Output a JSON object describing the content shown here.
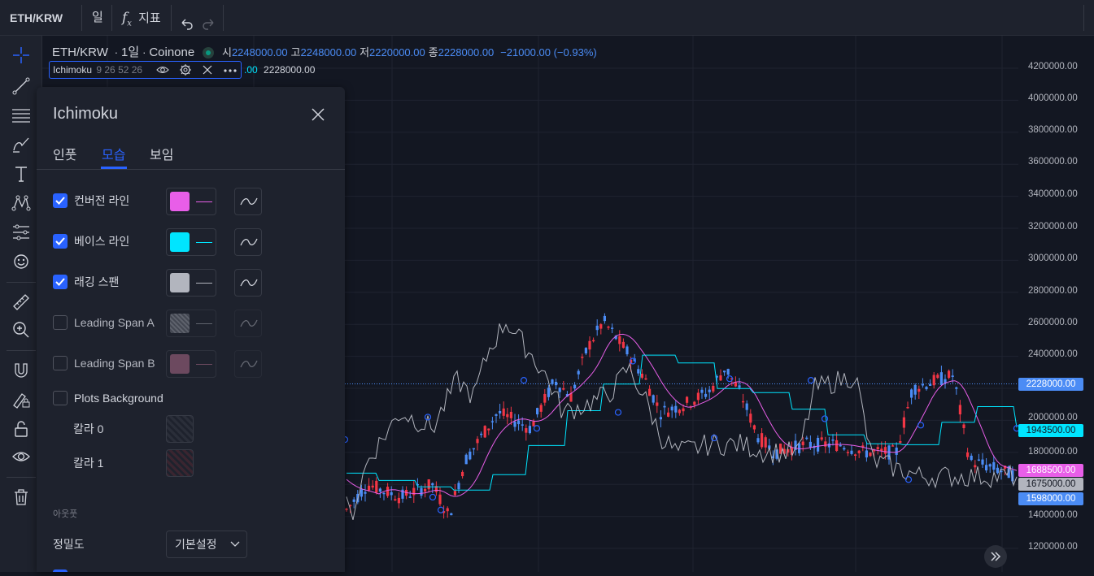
{
  "topbar": {
    "symbol": "ETH/KRW",
    "interval": "일",
    "indicators_label": "지표",
    "fx_f": "f",
    "fx_x": "x"
  },
  "sidebar": {
    "tools": [
      "crosshair-icon",
      "trendline-icon",
      "horizontal-lines-icon",
      "brush-icon",
      "text-icon",
      "pattern-icon",
      "prediction-icon",
      "emoji-icon",
      "ruler-icon",
      "zoom-in-icon",
      "magnet-icon",
      "lock-drawing-icon",
      "lock-icon",
      "eye-icon",
      "trash-icon"
    ]
  },
  "legend": {
    "symbol": "ETH/KRW",
    "interval": "1일",
    "exchange": "Coinone",
    "open_label": "시",
    "open": "2248000.00",
    "high_label": "고",
    "high": "2248000.00",
    "low_label": "저",
    "low": "2220000.00",
    "close_label": "종",
    "close": "2228000.00",
    "change": "−21000.00 (−0.93%)"
  },
  "indicator": {
    "name": "Ichimoku",
    "params": "9 26 52 26",
    "value1": ".00",
    "value2": "2228000.00"
  },
  "dialog": {
    "title": "Ichimoku",
    "tabs": [
      {
        "label": "인풋",
        "active": false
      },
      {
        "label": "모습",
        "active": true
      },
      {
        "label": "보임",
        "active": false
      }
    ],
    "rows": [
      {
        "label": "컨버전 라인",
        "checked": true,
        "color": "#e85ee8"
      },
      {
        "label": "베이스 라인",
        "checked": true,
        "color": "#00e5ff"
      },
      {
        "label": "래깅 스팬",
        "checked": true,
        "color": "#b2b5be"
      },
      {
        "label": "Leading Span A",
        "checked": false,
        "color": "#8a8d96"
      },
      {
        "label": "Leading Span B",
        "checked": false,
        "color": "#8e5a75"
      }
    ],
    "plots_background": {
      "label": "Plots Background",
      "checked": false
    },
    "color0_label": "칼라 0",
    "color1_label": "칼라 1",
    "outputs_section": "아웃풋",
    "precision_label": "정밀도",
    "precision_value": "기본설정"
  },
  "yaxis": {
    "ticks": [
      "4200000.00",
      "4000000.00",
      "3800000.00",
      "3600000.00",
      "3400000.00",
      "3200000.00",
      "3000000.00",
      "2800000.00",
      "2600000.00",
      "2400000.00",
      "2000000.00",
      "1800000.00",
      "1400000.00",
      "1200000.00"
    ],
    "tags": [
      {
        "text": "2228000.00",
        "bg": "#4b8cf5",
        "fg": "#ffffff"
      },
      {
        "text": "1943500.00",
        "bg": "#00e5ff",
        "fg": "#131722"
      },
      {
        "text": "1688500.00",
        "bg": "#e85ee8",
        "fg": "#ffffff"
      },
      {
        "text": "1675000.00",
        "bg": "#b2b5be",
        "fg": "#131722"
      },
      {
        "text": "1598000.00",
        "bg": "#4b8cf5",
        "fg": "#ffffff"
      }
    ]
  },
  "chart_data": {
    "type": "candlestick",
    "series_colors": {
      "up": "#f23645",
      "down": "#4b8cf5",
      "conversion": "#e85ee8",
      "base": "#00e5ff",
      "lagging": "#b2b5be"
    },
    "ylim": [
      1100000,
      4300000
    ],
    "last_close": 2228000
  }
}
